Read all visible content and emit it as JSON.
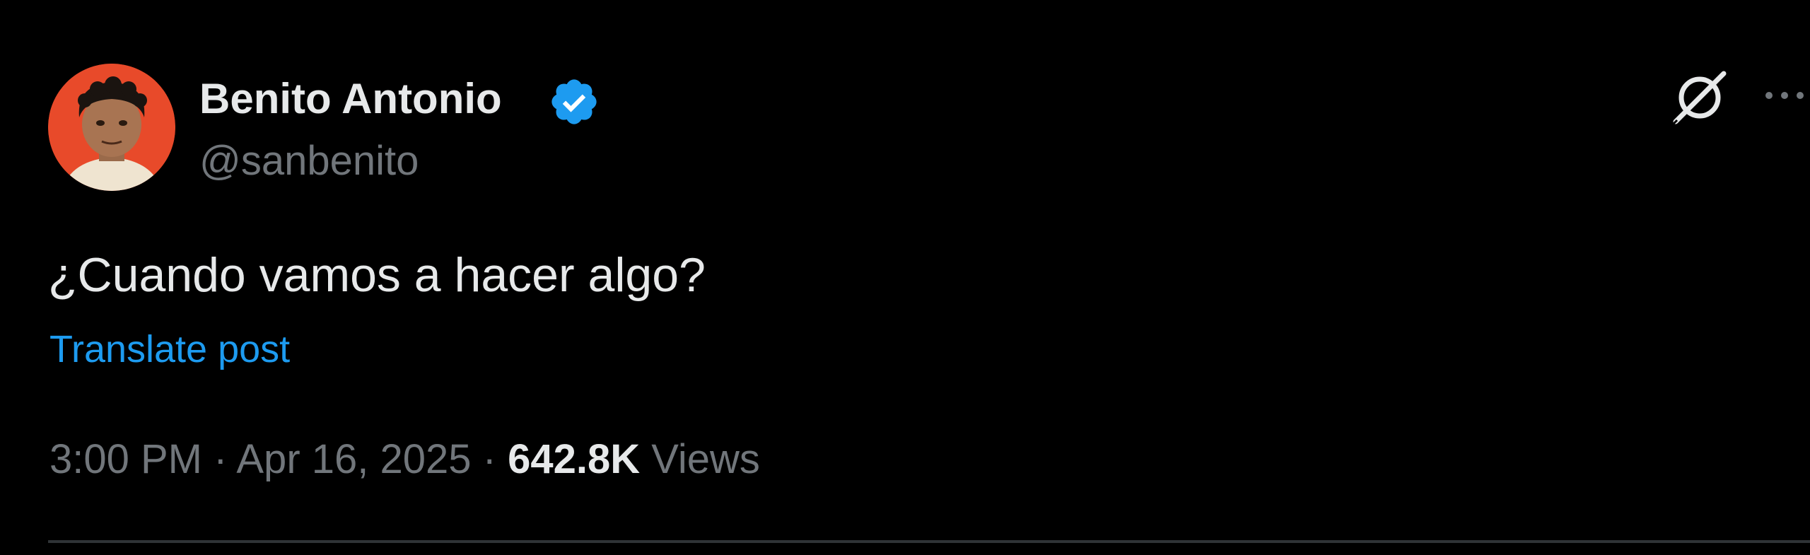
{
  "author": {
    "name": "Benito Antonio",
    "handle": "@sanbenito",
    "verified": true,
    "verified_color": "#1d9bf0",
    "avatar_background": "#e84a2a"
  },
  "post": {
    "text": "¿Cuando vamos a hacer algo?",
    "translate_label": "Translate post"
  },
  "meta": {
    "time": "3:00 PM",
    "separator": "·",
    "date": "Apr 16, 2025",
    "views_count": "642.8K",
    "views_label": "Views"
  },
  "actions": {
    "grok_icon": "grok-icon",
    "more_icon": "more-icon"
  },
  "theme": {
    "background": "#000000",
    "primary_text": "#e7e9ea",
    "secondary_text": "#71767b",
    "link": "#1d9bf0",
    "divider": "#2f3336"
  }
}
